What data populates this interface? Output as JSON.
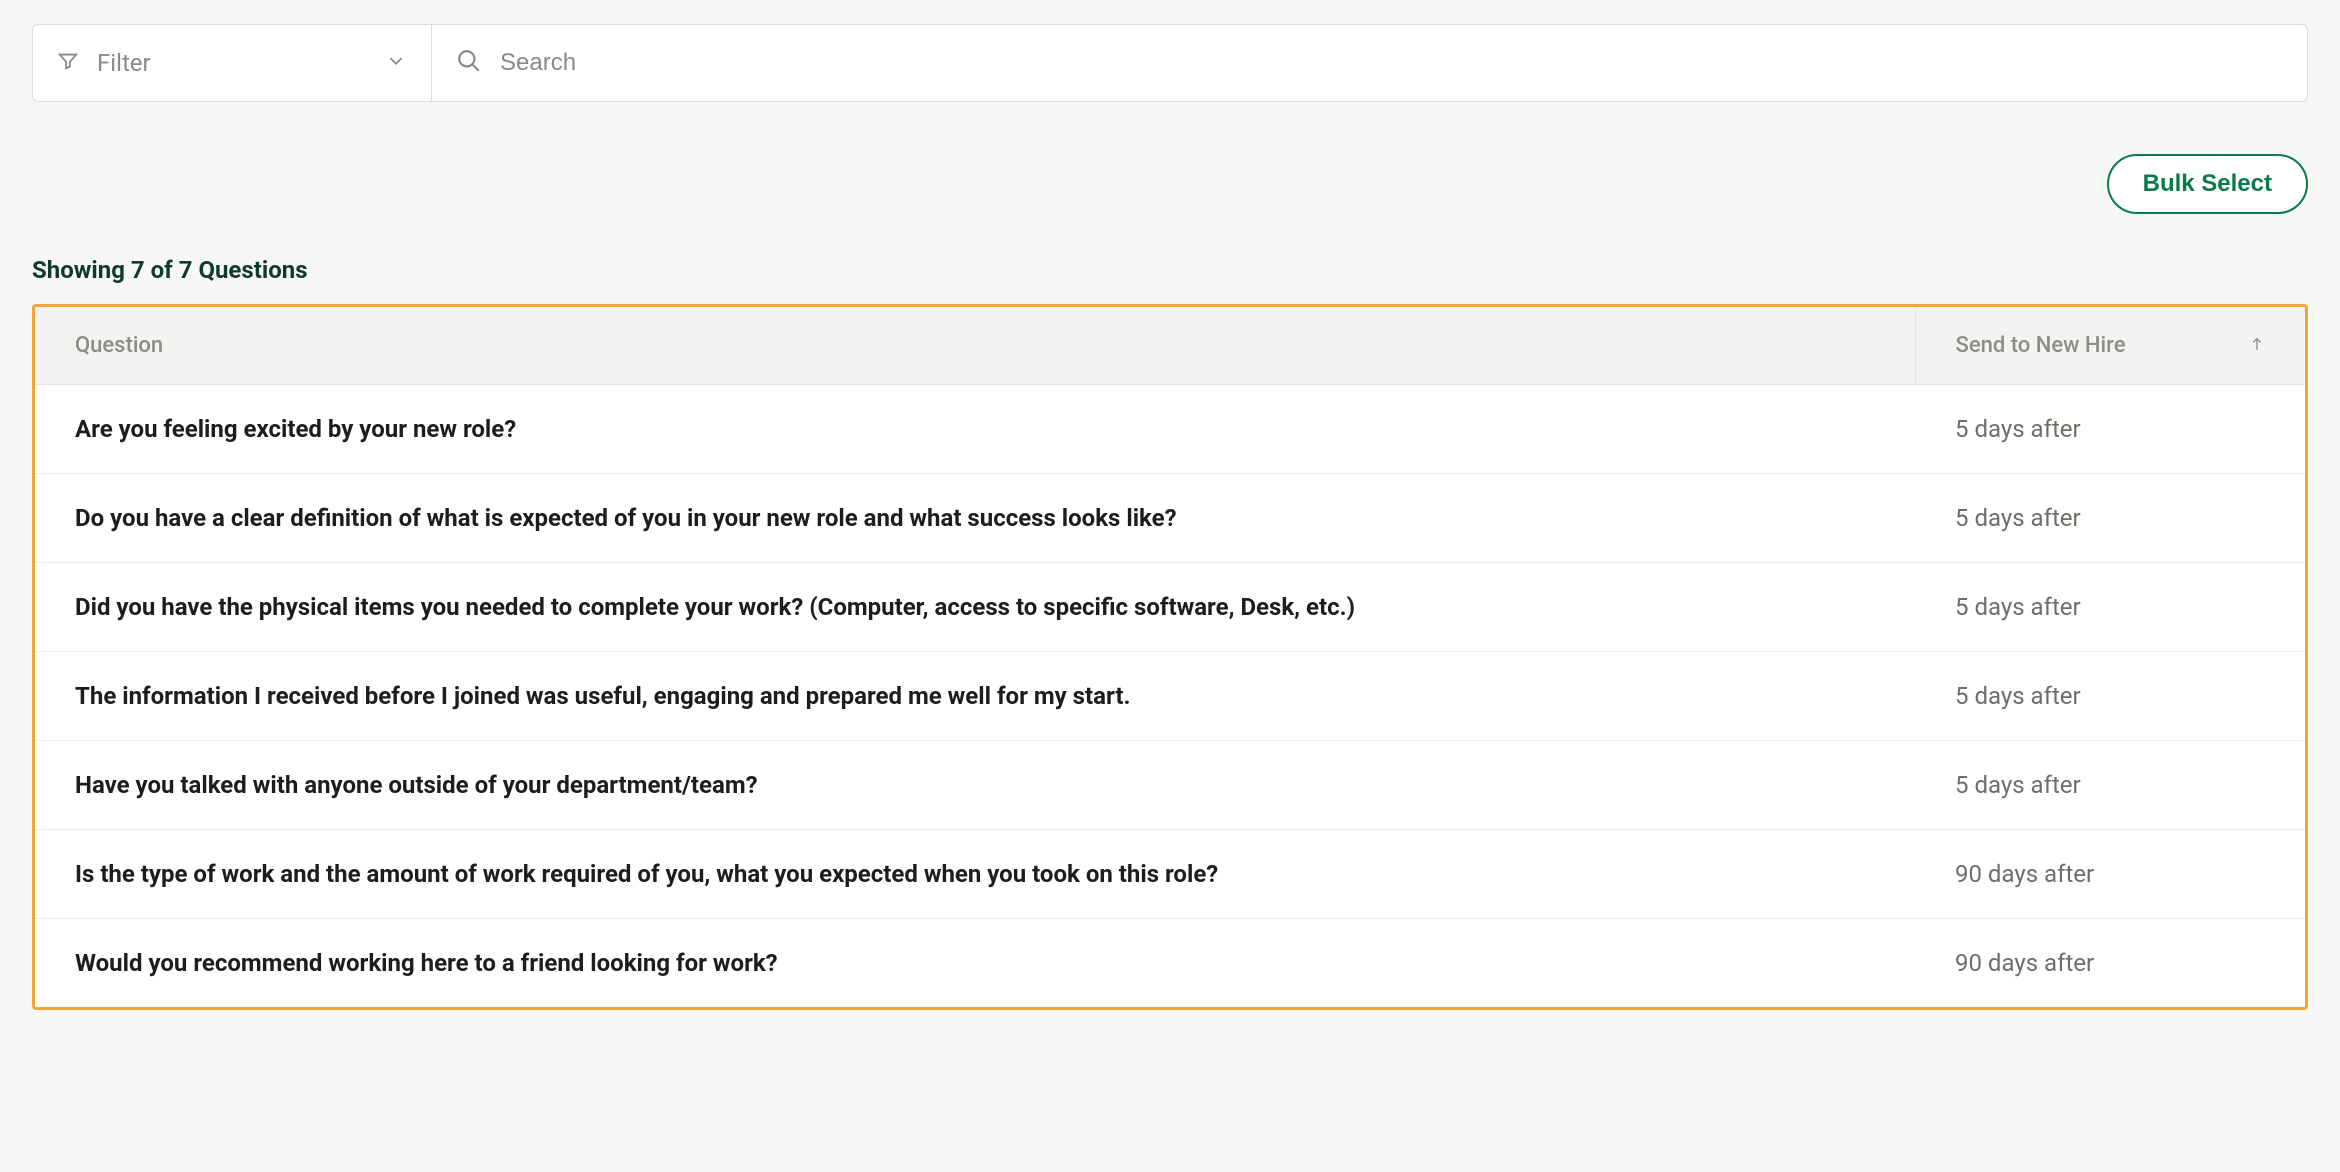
{
  "toolbar": {
    "filter_label": "Filter",
    "search_placeholder": "Search"
  },
  "actions": {
    "bulk_select": "Bulk Select"
  },
  "summary": "Showing 7 of 7 Questions",
  "table": {
    "headers": {
      "question": "Question",
      "send": "Send to New Hire"
    },
    "rows": [
      {
        "question": "Are you feeling excited by your new role?",
        "send": "5 days after"
      },
      {
        "question": "Do you have a clear definition of what is expected of you in your new role and what success looks like?",
        "send": "5 days after"
      },
      {
        "question": "Did you have the physical items you needed to complete your work? (Computer, access to specific software, Desk, etc.)",
        "send": "5 days after"
      },
      {
        "question": "The information I received before I joined was useful, engaging and prepared me well for my start.",
        "send": "5 days after"
      },
      {
        "question": "Have you talked with anyone outside of your department/team?",
        "send": "5 days after"
      },
      {
        "question": "Is the type of work and the amount of work required of you, what you expected when you took on this role?",
        "send": "90 days after"
      },
      {
        "question": "Would you recommend working here to a friend looking for work?",
        "send": "90 days after"
      }
    ]
  }
}
